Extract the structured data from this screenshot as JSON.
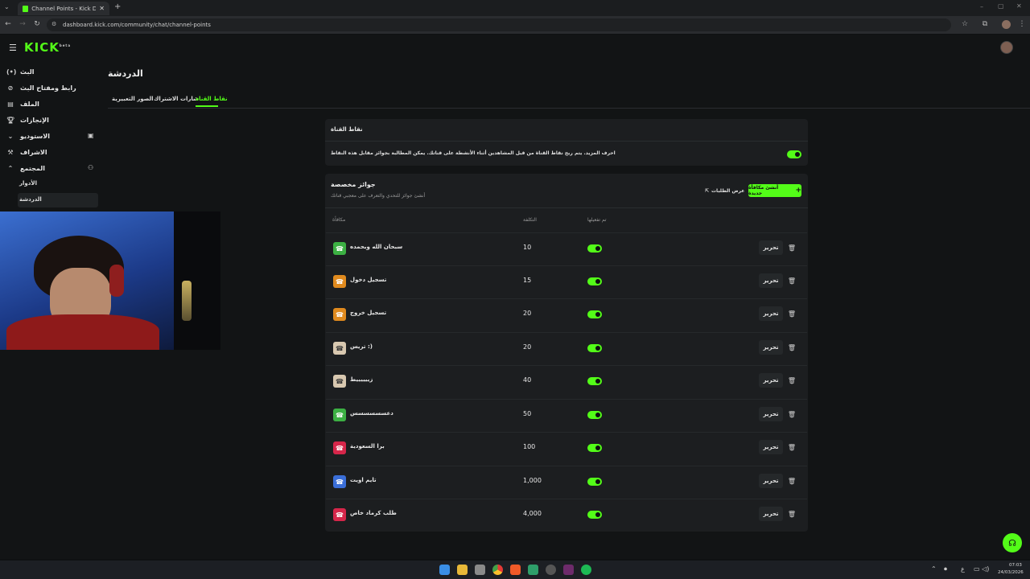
{
  "browser": {
    "tab_title": "Channel Points - Kick Dashboa",
    "url": "dashboard.kick.com/community/chat/channel-points"
  },
  "app": {
    "logo": "KICK",
    "logo_suffix": "beta"
  },
  "sidebar": {
    "items": [
      {
        "label": "البث",
        "icon": "broadcast-icon"
      },
      {
        "label": "رابط ومفتاح البث",
        "icon": "link-icon"
      },
      {
        "label": "الملف",
        "icon": "file-icon"
      },
      {
        "label": "الإنجازات",
        "icon": "trophy-icon"
      },
      {
        "label": "الاستوديو",
        "icon": "studio-icon"
      },
      {
        "label": "الاشراف",
        "icon": "gavel-icon"
      },
      {
        "label": "المجتمع",
        "icon": "community-icon"
      }
    ],
    "sub_items": [
      "الأدوار",
      "الدردشة"
    ]
  },
  "page": {
    "title": "الدردشة",
    "tabs": [
      "نقاط القناة",
      "شارات الاشتراك",
      "الصور التعبيرية"
    ],
    "active_tab": "نقاط القناة"
  },
  "channel_points": {
    "heading": "نقاط القناة",
    "description": "احرف المزيد. يتم ربح نقاط القناة من قبل المشاهدين أثناء الأنشطة على قناتك. يمكن المطالبة بجوائز مقابل هذه النقاط"
  },
  "custom_rewards": {
    "heading": "جوائز مخصصة",
    "subheading": "أنشئ جوائز للتحدي والتعرف على معجبي قناتك",
    "create_button": "أنشئ مكافأة جديدة",
    "requests_button": "عرض الطلبات",
    "columns": {
      "reward": "مكافأة",
      "cost": "التكلفة",
      "enabled": "تم تفعيلها"
    },
    "edit_label": "تحرير",
    "rows": [
      {
        "name": "سبحان الله وبحمده",
        "cost": "10",
        "color": "#3cb043"
      },
      {
        "name": "تسجيل دخول",
        "cost": "15",
        "color": "#e08a1e"
      },
      {
        "name": "تسجيل خروج",
        "cost": "20",
        "color": "#e08a1e"
      },
      {
        "name": "تريس :)",
        "cost": "20",
        "color": "#d8c8b0"
      },
      {
        "name": "زييييييط",
        "cost": "40",
        "color": "#d8c8b0"
      },
      {
        "name": "دعسسسسسس",
        "cost": "50",
        "color": "#3cb043"
      },
      {
        "name": "برا السعودية",
        "cost": "100",
        "color": "#d6264a"
      },
      {
        "name": "تايم اويت",
        "cost": "1,000",
        "color": "#3a6ed8"
      },
      {
        "name": "طلب كرماد خاص",
        "cost": "4,000",
        "color": "#d6264a"
      }
    ]
  },
  "taskbar": {
    "time": "07:03",
    "date": "24/03/2026",
    "lang": "ع"
  }
}
